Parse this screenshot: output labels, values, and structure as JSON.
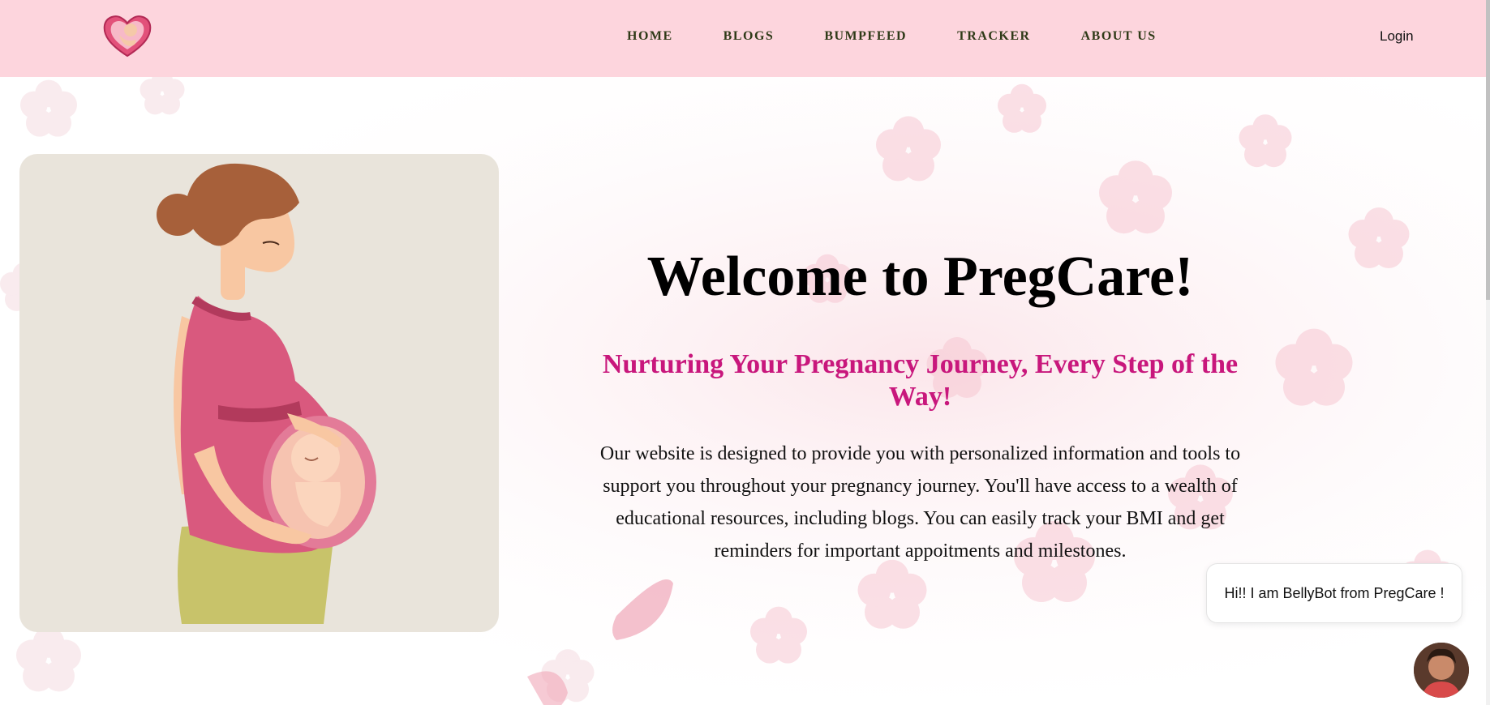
{
  "brand": {
    "logo_icon": "heart-baby-logo-icon",
    "accent": "#c8177c",
    "header_bg": "#fdd5dd"
  },
  "nav": {
    "items": [
      {
        "label": "HOME"
      },
      {
        "label": "BLOGS"
      },
      {
        "label": "BUMPFEED"
      },
      {
        "label": "TRACKER"
      },
      {
        "label": "ABOUT US"
      }
    ],
    "login_label": "Login"
  },
  "hero": {
    "title": "Welcome to PregCare!",
    "subtitle": "Nurturing Your Pregnancy Journey, Every Step of the Way!",
    "description": "Our website is designed to provide you with personalized information and tools to support you throughout your pregnancy journey. You'll have access to a wealth of educational resources, including blogs. You can easily track your BMI and get reminders for important appoitments and milestones.",
    "illustration": "pregnant-woman-illustration"
  },
  "chatbot": {
    "greeting": "Hi!! I am BellyBot from PregCare !",
    "avatar_icon": "bot-avatar"
  }
}
